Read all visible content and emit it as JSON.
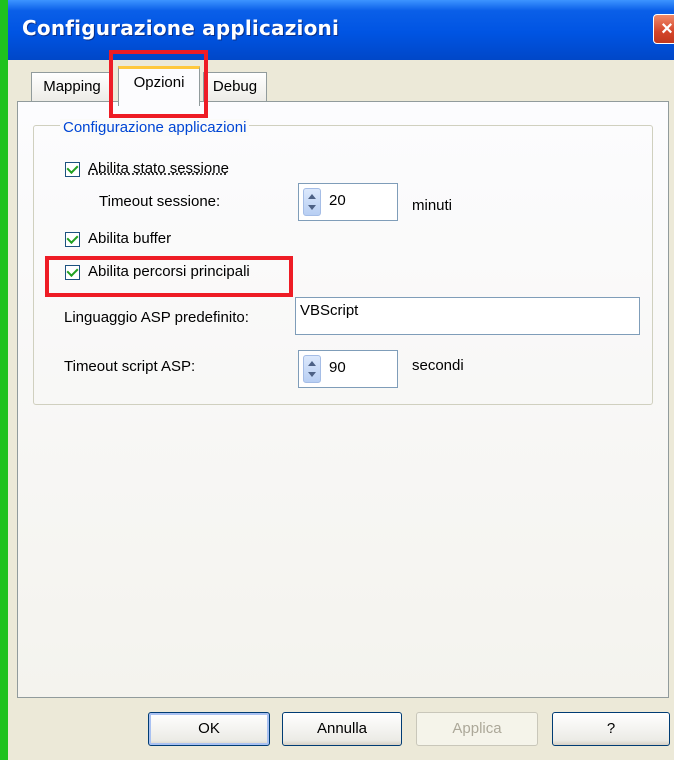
{
  "window": {
    "title": "Configurazione applicazioni",
    "close_glyph": "×"
  },
  "tabs": [
    {
      "label": "Mapping",
      "active": false
    },
    {
      "label": "Opzioni",
      "active": true
    },
    {
      "label": "Debug",
      "active": false
    }
  ],
  "group": {
    "title": "Configurazione applicazioni",
    "session_state": {
      "label": "Abilita stato sessione",
      "checked": true
    },
    "session_timeout": {
      "label": "Timeout sessione:",
      "value": "20",
      "unit": "minuti"
    },
    "buffer": {
      "label": "Abilita buffer",
      "checked": true
    },
    "parent_paths": {
      "label": "Abilita percorsi principali",
      "checked": true
    },
    "asp_language": {
      "label": "Linguaggio ASP predefinito:",
      "value": "VBScript"
    },
    "script_timeout": {
      "label": "Timeout script ASP:",
      "value": "90",
      "unit": "secondi"
    }
  },
  "buttons": {
    "ok": "OK",
    "cancel": "Annulla",
    "apply": "Applica",
    "help": "?"
  },
  "colors": {
    "highlight": "#ee1c25",
    "titlebar": "#0054e3",
    "group_title": "#0046d5"
  }
}
